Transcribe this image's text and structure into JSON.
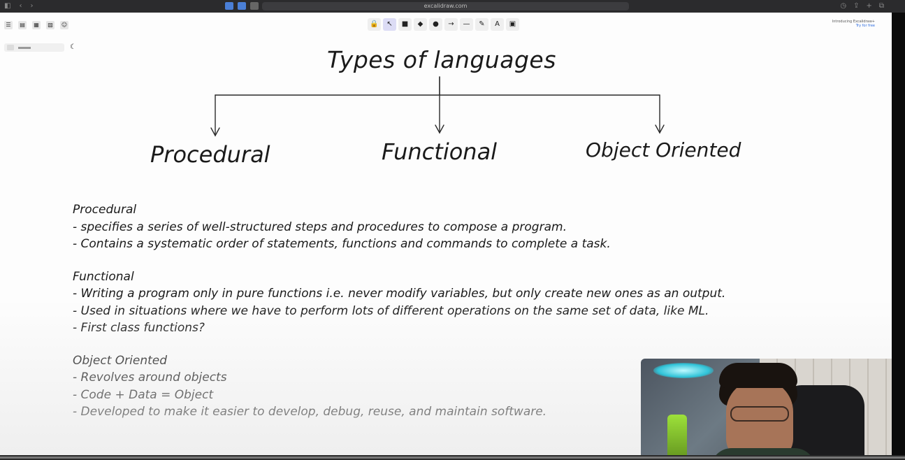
{
  "browser": {
    "nav": [
      "◧",
      "‹",
      "›"
    ],
    "url": "excalidraw.com",
    "right_icons": [
      "◷",
      "⇪",
      "+",
      "⧉"
    ]
  },
  "left_panel": {
    "tools": [
      "☰",
      "▤",
      "▦",
      "▧",
      "☺"
    ],
    "moon": "☾"
  },
  "toolbar": {
    "tools": [
      {
        "name": "lock-tool-icon",
        "glyph": "🔒"
      },
      {
        "name": "select-tool-icon",
        "glyph": "↖"
      },
      {
        "name": "rectangle-tool-icon",
        "glyph": "■"
      },
      {
        "name": "diamond-tool-icon",
        "glyph": "◆"
      },
      {
        "name": "ellipse-tool-icon",
        "glyph": "●"
      },
      {
        "name": "arrow-tool-icon",
        "glyph": "→"
      },
      {
        "name": "line-tool-icon",
        "glyph": "—"
      },
      {
        "name": "pencil-tool-icon",
        "glyph": "✎"
      },
      {
        "name": "text-tool-icon",
        "glyph": "A"
      },
      {
        "name": "image-tool-icon",
        "glyph": "▣"
      }
    ]
  },
  "promo": {
    "line1": "Introducing Excalidraw+",
    "line2": "Try for free"
  },
  "diagram": {
    "title": "Types of languages",
    "categories": [
      "Procedural",
      "Functional",
      "Object Oriented"
    ]
  },
  "notes": {
    "procedural": {
      "heading": "Procedural",
      "lines": [
        "- specifies a series of well-structured steps and procedures to compose a program.",
        "- Contains a systematic order of statements, functions and commands to complete a task."
      ]
    },
    "functional": {
      "heading": "Functional",
      "lines": [
        "- Writing a program only in pure functions i.e. never modify variables, but only create new ones as an output.",
        "- Used in situations where we have to perform lots of different operations on the same set of data, like ML.",
        "- First class functions?"
      ]
    },
    "object_oriented": {
      "heading": "Object Oriented",
      "lines": [
        "- Revolves around objects",
        "- Code + Data = Object",
        "- Developed to make it easier to develop, debug, reuse, and maintain software."
      ]
    }
  }
}
